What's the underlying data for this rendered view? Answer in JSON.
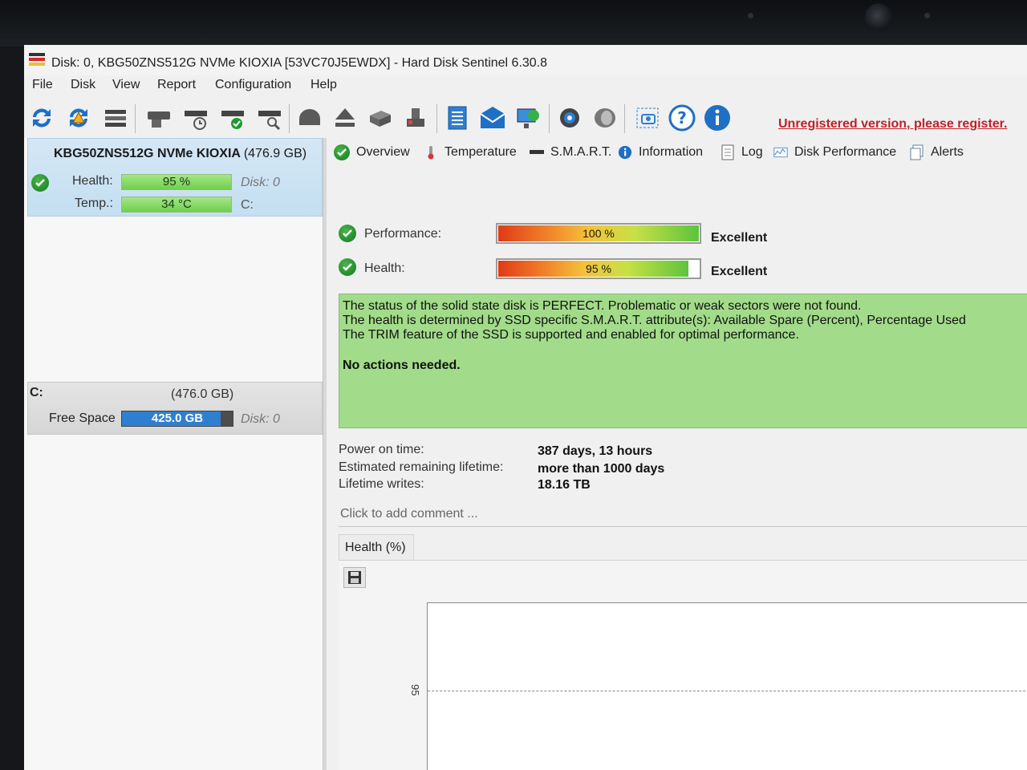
{
  "window": {
    "title": "Disk: 0, KBG50ZNS512G NVMe KIOXIA [53VC70J5EWDX]  -  Hard Disk Sentinel 6.30.8"
  },
  "menu": [
    "File",
    "Disk",
    "View",
    "Report",
    "Configuration",
    "Help"
  ],
  "toolbar": {
    "icons": [
      "refresh-icon",
      "refresh-warning-icon",
      "disk-list-icon",
      "disk-icon",
      "disk-schedule-icon",
      "disk-check-icon",
      "disk-search-icon",
      "disk-shield-icon",
      "eject-icon",
      "server-icon",
      "disk-tools-icon",
      "report-icon",
      "email-icon",
      "network-icon",
      "settings-icon",
      "speaker-icon",
      "screenshot-icon",
      "help-icon",
      "info-icon"
    ],
    "unregistered_text": "Unregistered version, please register."
  },
  "disk": {
    "name": "KBG50ZNS512G NVMe KIOXIA",
    "size": "(476.9 GB)",
    "health_label": "Health:",
    "health_value": "95 %",
    "health_fraction": 0.95,
    "temp_label": "Temp.:",
    "temp_value": "34 °C",
    "disk_ref": "Disk: 0",
    "drive_ref": "C:"
  },
  "drive": {
    "letter": "C:",
    "size": "(476.0 GB)",
    "free_label": "Free Space",
    "free_value": "425.0 GB",
    "free_fraction": 0.89,
    "disk_ref": "Disk: 0"
  },
  "tabs": [
    "Overview",
    "Temperature",
    "S.M.A.R.T.",
    "Information",
    "Log",
    "Disk Performance",
    "Alerts"
  ],
  "metrics": {
    "performance_label": "Performance:",
    "performance_value": "100 %",
    "performance_fraction": 1.0,
    "performance_rating": "Excellent",
    "health_label": "Health:",
    "health_value": "95 %",
    "health_fraction": 0.95,
    "health_rating": "Excellent"
  },
  "status": {
    "line1": "The status of the solid state disk is PERFECT. Problematic or weak sectors were not found.",
    "line2": "The health is determined by SSD specific S.M.A.R.T. attribute(s):  Available Spare (Percent), Percentage Used",
    "line3": "The TRIM feature of the SSD is supported and enabled for optimal performance.",
    "action": "No actions needed."
  },
  "info": {
    "power_on_label": "Power on time:",
    "power_on_value": "387 days, 13 hours",
    "lifetime_label": "Estimated remaining lifetime:",
    "lifetime_value": "more than 1000 days",
    "writes_label": "Lifetime writes:",
    "writes_value": "18.16 TB"
  },
  "comment": {
    "placeholder": "Click to add comment ..."
  },
  "chart": {
    "tab_label": "Health (%)"
  },
  "chart_data": {
    "type": "line",
    "title": "",
    "ylabel": "",
    "yticks": [
      95
    ],
    "ylim": [
      94,
      96
    ],
    "series": [
      {
        "values": [
          95
        ]
      }
    ]
  }
}
